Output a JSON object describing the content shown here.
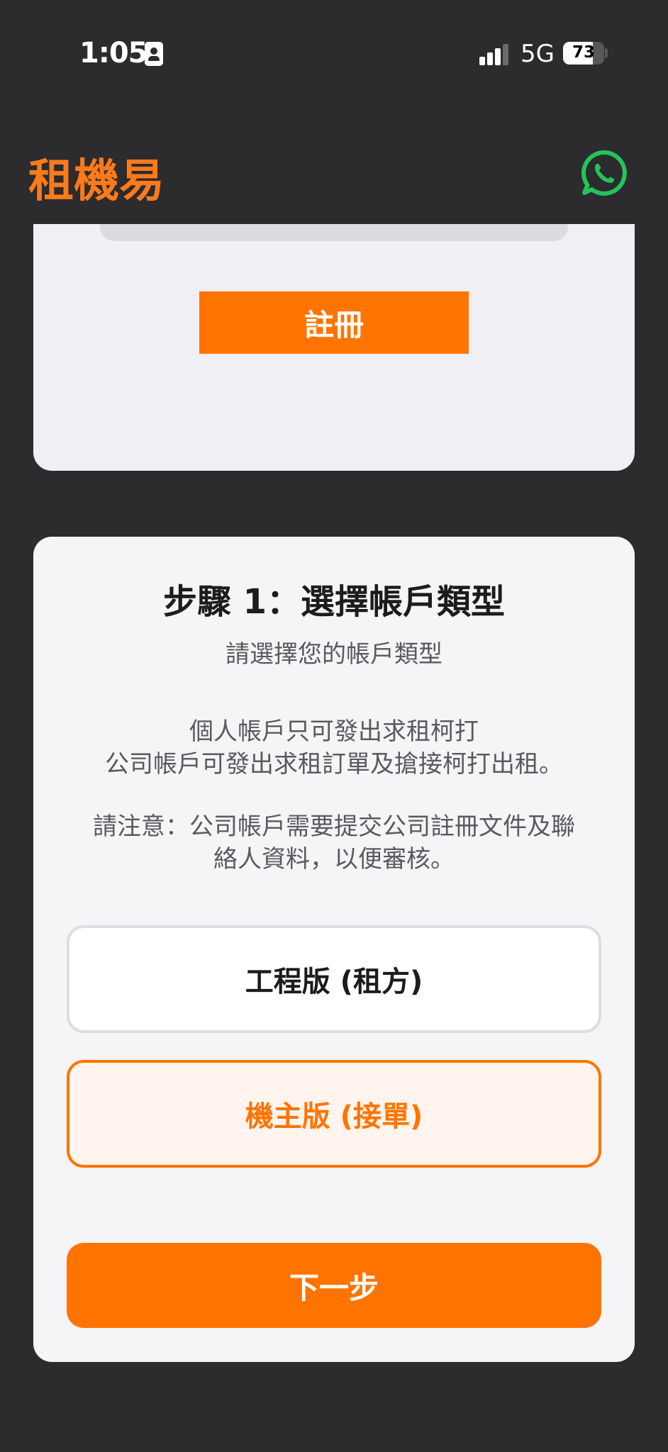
{
  "status_bar": {
    "time": "1:05",
    "network": "5G",
    "battery": "73",
    "battery_level": 0.73
  },
  "header": {
    "title": "租機易",
    "whatsapp_icon": "whatsapp-icon"
  },
  "top_card": {
    "register_label": "註冊"
  },
  "step_card": {
    "title": "步驟 1：選擇帳戶類型",
    "subtitle": "請選擇您的帳戶類型",
    "description_line1": "個人帳戶只可發出求租柯打",
    "description_line2": "公司帳戶可發出求租訂單及搶接柯打出租。",
    "notice_line1": "請注意：公司帳戶需要提交公司註冊文件及聯",
    "notice_line2": "絡人資料，以便審核。",
    "options": [
      {
        "label": "工程版 (租方)",
        "selected": false
      },
      {
        "label": "機主版 (接單)",
        "selected": true
      }
    ],
    "next_label": "下一步"
  },
  "colors": {
    "accent": "#ff7400",
    "whatsapp": "#25c35a",
    "background": "#2c2b2e"
  }
}
